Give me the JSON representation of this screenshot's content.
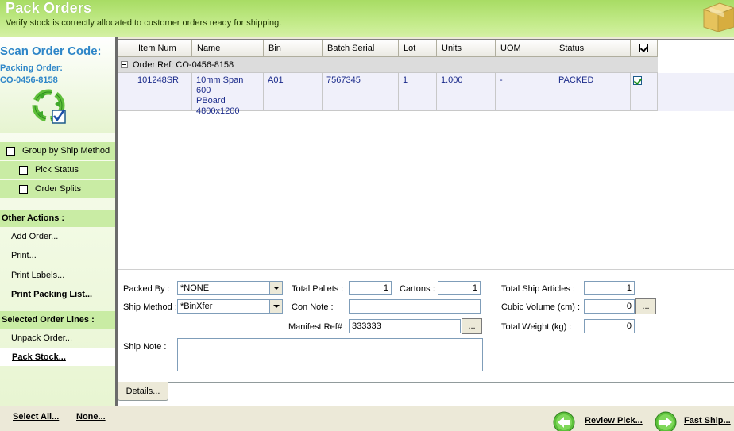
{
  "header": {
    "title": "Pack Orders",
    "subtitle": "Verify stock is correctly allocated to customer orders ready for shipping."
  },
  "left": {
    "scan_title": "Scan Order Code:",
    "packing_label": "Packing Order:",
    "packing_code": "CO-0456-8158",
    "options": {
      "group_by": "Group by Ship Method",
      "pick_status": "Pick Status",
      "order_splits": "Order Splits"
    },
    "other_actions_head": "Other Actions :",
    "other_actions": [
      "Add Order...",
      "Print...",
      "Print Labels...",
      "Print Packing List..."
    ],
    "selected_head": "Selected Order Lines :",
    "selected_actions": [
      "Unpack Order...",
      "Pack Stock..."
    ]
  },
  "grid": {
    "columns": [
      "Item Num",
      "Name",
      "Bin",
      "Batch Serial",
      "Lot",
      "Units",
      "UOM",
      "Status"
    ],
    "group_label": "Order Ref: CO-0456-8158",
    "rows": [
      {
        "item_num": "101248SR",
        "name_1": "10mm Span 600",
        "name_2": "PBoard",
        "name_3": "4800x1200",
        "bin": "A01",
        "batch_serial": "7567345",
        "lot": "1",
        "units": "1.000",
        "uom": "-",
        "status": "PACKED"
      }
    ]
  },
  "form": {
    "packed_by_label": "Packed By :",
    "packed_by_value": "*NONE",
    "ship_method_label": "Ship Method :",
    "ship_method_value": "*BinXfer",
    "total_pallets_label": "Total Pallets :",
    "total_pallets_value": "1",
    "cartons_label": "Cartons :",
    "cartons_value": "1",
    "con_note_label": "Con Note :",
    "con_note_value": "",
    "manifest_label": "Manifest Ref# :",
    "manifest_value": "333333",
    "total_ship_articles_label": "Total Ship Articles :",
    "total_ship_articles_value": "1",
    "cubic_volume_label": "Cubic Volume (cm) :",
    "cubic_volume_value": "0",
    "total_weight_label": "Total Weight (kg) :",
    "total_weight_value": "0",
    "ship_note_label": "Ship Note :",
    "ellipsis": "...",
    "details_tab": "Details..."
  },
  "footer": {
    "select_all": "Select All...",
    "none": "None...",
    "review_pick": "Review Pick...",
    "fast_ship": "Fast Ship..."
  },
  "colors": {
    "header_green": "#b6e47a",
    "accent_blue": "#2e86c8",
    "panel_green": "#c9eca4"
  }
}
